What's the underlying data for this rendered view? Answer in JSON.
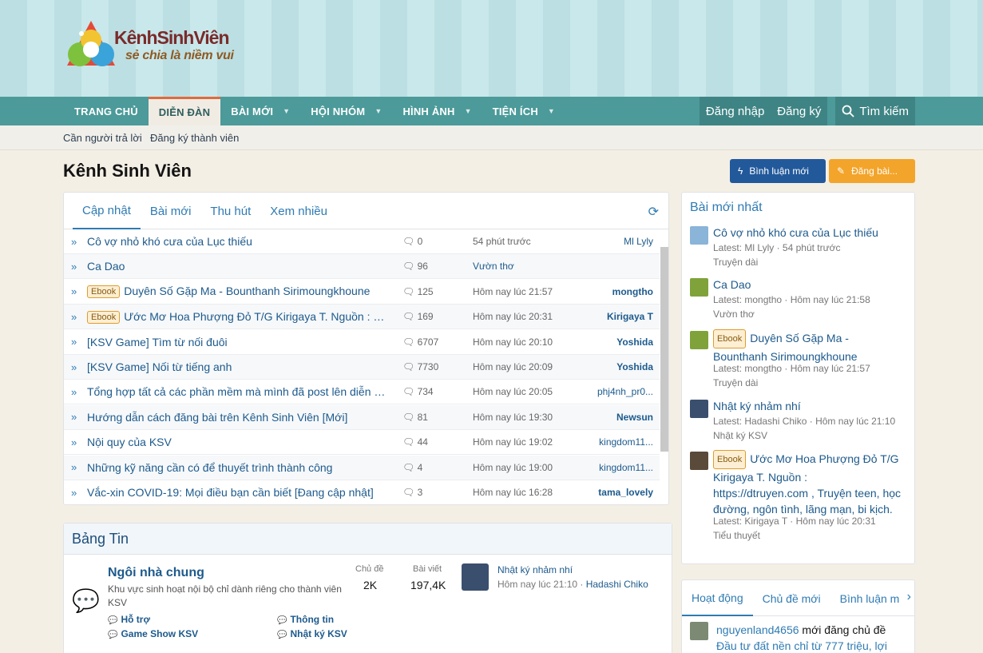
{
  "logo": {
    "line1a": "Kênh",
    "line1b": "Sinh",
    "line1c": "Viên",
    "line2": "sẻ chia là niềm vui"
  },
  "nav": {
    "tabs": [
      {
        "label": "TRANG CHỦ"
      },
      {
        "label": "DIỄN ĐÀN"
      },
      {
        "label": "BÀI MỚI"
      },
      {
        "label": "HỘI NHÓM"
      },
      {
        "label": "HÌNH ẢNH"
      },
      {
        "label": "TIỆN ÍCH"
      }
    ],
    "login": "Đăng nhập",
    "register": "Đăng ký",
    "search": "Tìm kiếm"
  },
  "subnav": {
    "link1": "Cần người trả lời",
    "link2": "Đăng ký thành viên"
  },
  "page": {
    "title": "Kênh Sinh Viên",
    "btn_comment": "Bình luận mới",
    "btn_post": "Đăng bài..."
  },
  "main": {
    "tabs": [
      "Cập nhật",
      "Bài mới",
      "Thu hút",
      "Xem nhiều"
    ],
    "threads": [
      {
        "prefix": "",
        "title": "Cô vợ nhỏ khó cưa của Lục thiếu",
        "replies": "0",
        "time": "54 phút trước",
        "user": "Ml Lyly"
      },
      {
        "prefix": "",
        "title": "Ca Dao",
        "replies": "96",
        "time": "Vườn thơ",
        "user": ""
      },
      {
        "prefix": "Ebook",
        "title": "Duyên Số Gặp Ma - Bounthanh Sirimoungkhoune",
        "replies": "125",
        "time": "Hôm nay lúc 21:57",
        "user": "mongtho"
      },
      {
        "prefix": "Ebook",
        "title": "Ước Mơ Hoa Phượng Đỏ T/G Kirigaya T. Nguồn : https://dtruyen.com",
        "replies": "169",
        "time": "Hôm nay lúc 20:31",
        "user": "Kirigaya T"
      },
      {
        "prefix": "",
        "title": "[KSV Game] Tìm từ nối đuôi",
        "replies": "6707",
        "time": "Hôm nay lúc 20:10",
        "user": "Yoshida"
      },
      {
        "prefix": "",
        "title": "[KSV Game] Nối từ tiếng anh",
        "replies": "7730",
        "time": "Hôm nay lúc 20:09",
        "user": "Yoshida"
      },
      {
        "prefix": "",
        "title": "Tổng hợp tất cả các phần mềm mà mình đã post lên diễn đàn",
        "replies": "734",
        "time": "Hôm nay lúc 20:05",
        "user": "phj4nh_pr0..."
      },
      {
        "prefix": "",
        "title": "Hướng dẫn cách đăng bài trên Kênh Sinh Viên [Mới]",
        "replies": "81",
        "time": "Hôm nay lúc 19:30",
        "user": "Newsun"
      },
      {
        "prefix": "",
        "title": "Nội quy của KSV",
        "replies": "44",
        "time": "Hôm nay lúc 19:02",
        "user": "kingdom11..."
      },
      {
        "prefix": "",
        "title": "Những kỹ năng cần có để thuyết trình thành công",
        "replies": "4",
        "time": "Hôm nay lúc 19:00",
        "user": "kingdom11..."
      },
      {
        "prefix": "",
        "title": "Vắc-xin COVID-19: Mọi điều bạn cần biết [Đang cập nhật]",
        "replies": "3",
        "time": "Hôm nay lúc 16:28",
        "user": "tama_lovely"
      }
    ]
  },
  "bang": {
    "title": "Bảng Tin",
    "forum_title": "Ngôi nhà chung",
    "forum_desc": "Khu vực sinh hoạt nội bộ chỉ dành riêng cho thành viên KSV",
    "topics_label": "Chủ đề",
    "topics": "2K",
    "posts_label": "Bài viết",
    "posts": "197,4K",
    "last_title": "Nhật ký nhảm nhí",
    "last_meta": "Hôm nay lúc 21:10 · ",
    "last_user": "Hadashi Chiko",
    "subforums": [
      "Hỗ trợ",
      "Thông tin",
      "Game Show KSV",
      "Nhật ký KSV"
    ]
  },
  "side": {
    "title": "Bài mới nhất",
    "items": [
      {
        "prefix": "",
        "title": "Cô vợ nhỏ khó cưa của Lục thiếu",
        "meta": "Latest: Ml Lyly · 54 phút trước",
        "forum": "Truyện dài"
      },
      {
        "prefix": "",
        "title": "Ca Dao",
        "meta": "Latest: mongtho · Hôm nay lúc 21:58",
        "forum": "Vườn thơ"
      },
      {
        "prefix": "Ebook",
        "title": "Duyên Số Gặp Ma - Bounthanh Sirimoungkhoune",
        "meta": "Latest: mongtho · Hôm nay lúc 21:57",
        "forum": "Truyện dài"
      },
      {
        "prefix": "",
        "title": "Nhật ký nhảm nhí",
        "meta": "Latest: Hadashi Chiko · Hôm nay lúc 21:10",
        "forum": "Nhật ký KSV"
      },
      {
        "prefix": "Ebook",
        "title": "Ước Mơ Hoa Phượng Đỏ T/G Kirigaya T. Nguồn : https://dtruyen.com , Truyện teen, học đường, ngôn tình, lãng mạn, bi kịch.",
        "meta": "Latest: Kirigaya T · Hôm nay lúc 20:31",
        "forum": "Tiểu thuyết"
      }
    ]
  },
  "activity": {
    "tabs": [
      "Hoạt động",
      "Chủ đề mới",
      "Bình luận m"
    ],
    "user": "nguyenland4656",
    "text": " mới đăng chủ đề ",
    "thread": "Đầu tư đất nền chỉ từ 777 triệu, lợi"
  },
  "colors": {
    "nav": "#4c9a9a",
    "accent_blue": "#22599b",
    "accent_orange": "#f3a42a",
    "link": "#2f7bb3"
  }
}
